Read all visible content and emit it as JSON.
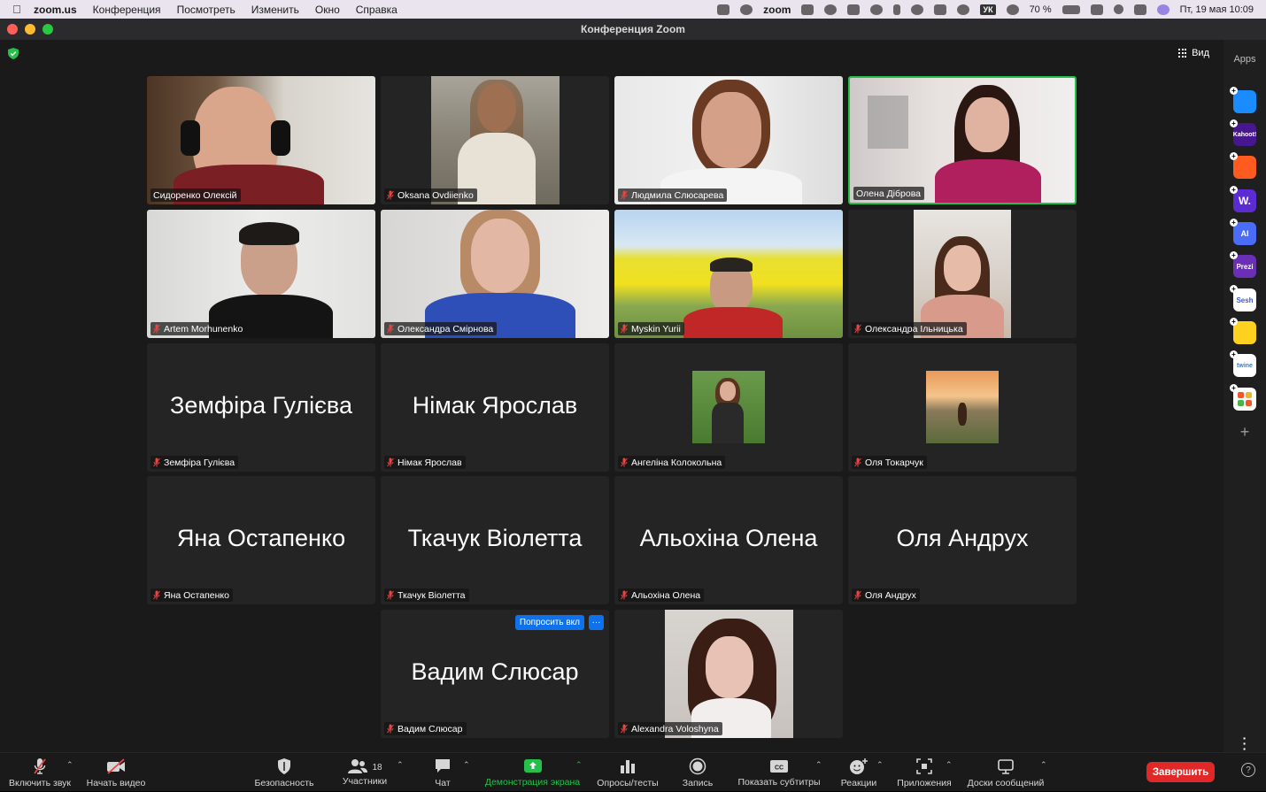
{
  "menubar": {
    "app_name": "zoom.us",
    "items": [
      "Конференция",
      "Посмотреть",
      "Изменить",
      "Окно",
      "Справка"
    ],
    "zoom_label": "zoom",
    "keyboard": "УК",
    "battery": "70 %",
    "datetime": "Пт, 19 мая  10:09"
  },
  "window": {
    "title": "Конференция Zoom"
  },
  "view_button": "Вид",
  "tiles": [
    {
      "name": "Сидоренко Олексій",
      "video": true,
      "muted": false,
      "speaking": false
    },
    {
      "name": "Oksana Ovdiienko",
      "video": true,
      "muted": true,
      "speaking": false
    },
    {
      "name": "Людмила Слюсарева",
      "video": true,
      "muted": true,
      "speaking": false
    },
    {
      "name": "Олена Діброва",
      "video": true,
      "muted": false,
      "speaking": true
    },
    {
      "name": "Artem Morhunenko",
      "video": true,
      "muted": true,
      "speaking": false
    },
    {
      "name": "Олександра Смірнова",
      "video": true,
      "muted": true,
      "speaking": false
    },
    {
      "name": "Myskin Yurii",
      "video": true,
      "muted": true,
      "speaking": false
    },
    {
      "name": "Олександра Ільницька",
      "video": true,
      "muted": true,
      "speaking": false
    },
    {
      "name": "Земфіра Гулієва",
      "big": "Земфіра Гулієва",
      "muted": true
    },
    {
      "name": "Німак Ярослав",
      "big": "Німак Ярослав",
      "muted": true
    },
    {
      "name": "Ангеліна Колокольна",
      "video": false,
      "photo": true,
      "muted": true
    },
    {
      "name": "Оля Токарчук",
      "video": false,
      "photo": true,
      "muted": true
    },
    {
      "name": "Яна Остапенко",
      "big": "Яна Остапенко",
      "muted": true
    },
    {
      "name": "Ткачук Віолетта",
      "big": "Ткачук Віолетта",
      "muted": true
    },
    {
      "name": "Альохіна Олена",
      "big": "Альохіна Олена",
      "muted": true
    },
    {
      "name": "Оля Андрух",
      "big": "Оля Андрух",
      "muted": true
    },
    {
      "name": "Вадим Слюсар",
      "big": "Вадим Слюсар",
      "muted": true,
      "ask_label": "Попросить вкл",
      "more_label": "···"
    },
    {
      "name": "Alexandra Voloshyna",
      "video": true,
      "muted": true
    }
  ],
  "sidebar": {
    "apps_label": "Apps",
    "apps": [
      {
        "label": "",
        "color": "#1a8cff",
        "icon": "play-app-icon"
      },
      {
        "label": "Kahoot!",
        "color": "#46178f",
        "icon": "kahoot-icon"
      },
      {
        "label": "",
        "color": "#ff5a1f",
        "icon": "orange-app-icon"
      },
      {
        "label": "W.",
        "color": "#5b2cd1",
        "icon": "wooclap-icon"
      },
      {
        "label": "AI",
        "color": "#4a6cf7",
        "icon": "ai-app-icon"
      },
      {
        "label": "Prezi",
        "color": "#6a2fb5",
        "icon": "prezi-icon"
      },
      {
        "label": "Sesh",
        "color": "#ffffff",
        "icon": "sesh-icon"
      },
      {
        "label": "",
        "color": "#ffd21f",
        "icon": "emoji-app-icon"
      },
      {
        "label": "twine",
        "color": "#ffffff",
        "icon": "twine-icon"
      },
      {
        "label": "",
        "color": "#ffffff",
        "icon": "grid-app-icon"
      }
    ]
  },
  "toolbar": {
    "unmute": "Включить звук",
    "start_video": "Начать видео",
    "security": "Безопасность",
    "participants": "Участники",
    "participants_count": "18",
    "chat": "Чат",
    "share": "Демонстрация экрана",
    "polls": "Опросы/тесты",
    "record": "Запись",
    "captions": "Показать субтитры",
    "reactions": "Реакции",
    "apps": "Приложения",
    "whiteboards": "Доски сообщений",
    "end": "Завершить",
    "help": "?"
  },
  "colors": {
    "speaking_border": "#25c04a",
    "share_green": "#25c04a",
    "end_red": "#e02828",
    "ask_blue": "#0e72ed"
  }
}
